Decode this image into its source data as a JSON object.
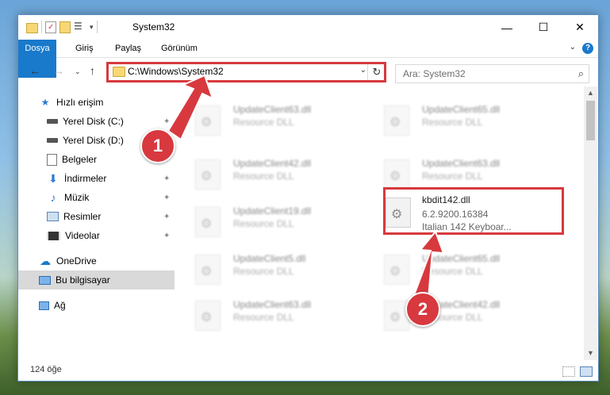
{
  "window": {
    "title": "System32",
    "minimize": "—",
    "maximize": "☐",
    "close": "✕"
  },
  "ribbon": {
    "tabs": [
      "Dosya",
      "Giriş",
      "Paylaş",
      "Görünüm"
    ],
    "help": "?"
  },
  "address": {
    "path": "C:\\Windows\\System32",
    "search_placeholder": "Ara: System32"
  },
  "sidebar": {
    "items": [
      {
        "label": "Hızlı erişim",
        "icon": "star-icon"
      },
      {
        "label": "Yerel Disk (C:)",
        "icon": "drive-icon",
        "pinned": true
      },
      {
        "label": "Yerel Disk (D:)",
        "icon": "drive-icon",
        "pinned": true
      },
      {
        "label": "Belgeler",
        "icon": "documents-icon",
        "pinned": true
      },
      {
        "label": "İndirmeler",
        "icon": "download-icon",
        "pinned": true
      },
      {
        "label": "Müzik",
        "icon": "music-icon",
        "pinned": true
      },
      {
        "label": "Resimler",
        "icon": "pictures-icon",
        "pinned": true
      },
      {
        "label": "Videolar",
        "icon": "videos-icon",
        "pinned": true
      },
      {
        "label": "OneDrive",
        "icon": "cloud-icon"
      },
      {
        "label": "Bu bilgisayar",
        "icon": "computer-icon",
        "selected": true
      },
      {
        "label": "Ağ",
        "icon": "network-icon"
      }
    ]
  },
  "files": {
    "left": [
      {
        "name": "UpdateClient63.dll",
        "desc": "Resource DLL"
      },
      {
        "name": "UpdateClient42.dll",
        "desc": "Resource DLL"
      },
      {
        "name": "UpdateClient19.dll",
        "desc": "Resource DLL"
      },
      {
        "name": "UpdateClient5.dll",
        "desc": "Resource DLL"
      },
      {
        "name": "UpdateClient63.dll",
        "desc": "Resource DLL"
      }
    ],
    "right": [
      {
        "name": "UpdateClient65.dll",
        "desc": "Resource DLL"
      },
      {
        "name": "UpdateClient63.dll",
        "desc": "Resource DLL"
      },
      {
        "name": "kbdit142.dll",
        "desc": "6.2.9200.16384",
        "desc2": "Italian 142 Keyboar..."
      },
      {
        "name": "UpdateClient65.dll",
        "desc": "Resource DLL"
      },
      {
        "name": "UpdateClient42.dll",
        "desc": "Resource DLL"
      }
    ]
  },
  "status": {
    "count": "124 öğe"
  },
  "markers": [
    "1",
    "2"
  ],
  "colors": {
    "accent": "#1979ca",
    "highlight": "#d7393e",
    "selected_nav": "#d9d9d9"
  }
}
